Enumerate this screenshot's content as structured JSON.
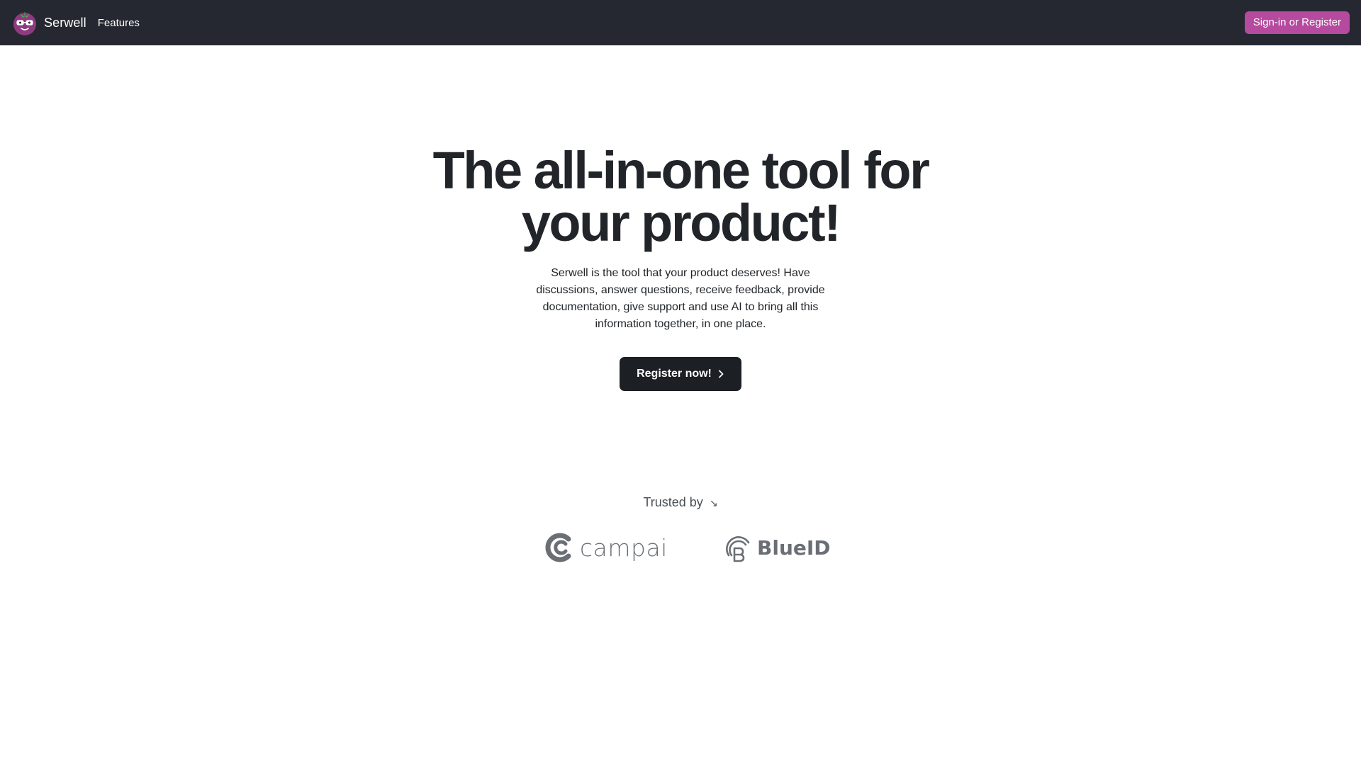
{
  "navbar": {
    "brand_name": "Serwell",
    "features_label": "Features",
    "signin_label": "Sign-in or Register",
    "brand_icon": "serwell-berry-logo-icon"
  },
  "hero": {
    "title": "The all-in-one tool for your product!",
    "description": "Serwell is the tool that your product deserves! Have discussions, answer questions, receive feedback, provide documentation, give support and use AI to bring all this information together, in one place.",
    "register_label": "Register now!",
    "register_icon": "chevron-right-icon"
  },
  "trusted": {
    "label": "Trusted by",
    "arrow": "↘",
    "logos": [
      {
        "name": "campai",
        "icon": "campai-logo-icon"
      },
      {
        "name": "BlueID",
        "icon": "blueid-logo-icon"
      }
    ]
  },
  "colors": {
    "navbar_bg": "#252830",
    "accent": "#b54a9f",
    "button_dark": "#1c1f23",
    "logo_gray": "#6b6f75"
  }
}
